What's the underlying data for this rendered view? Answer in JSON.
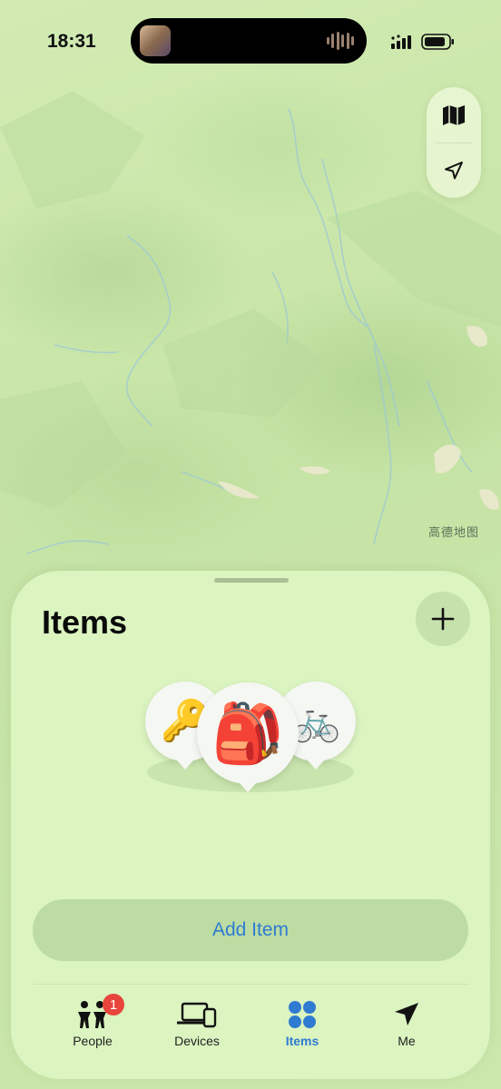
{
  "status_bar": {
    "time": "18:31"
  },
  "map": {
    "attribution": "高德地图"
  },
  "map_controls": {
    "map_mode_icon": "map-icon",
    "locate_icon": "location-arrow-icon"
  },
  "sheet": {
    "title": "Items",
    "add_icon": "plus-icon",
    "items": [
      {
        "name": "keys",
        "emoji": "🔑"
      },
      {
        "name": "backpack",
        "emoji": "🎒"
      },
      {
        "name": "bike",
        "emoji": "🚲"
      }
    ],
    "add_item_label": "Add Item"
  },
  "tab_bar": {
    "tabs": [
      {
        "label": "People",
        "icon": "people-icon",
        "badge": "1",
        "active": false
      },
      {
        "label": "Devices",
        "icon": "devices-icon",
        "active": false
      },
      {
        "label": "Items",
        "icon": "items-icon",
        "active": true
      },
      {
        "label": "Me",
        "icon": "location-arrow-icon",
        "active": false
      }
    ]
  },
  "colors": {
    "accent": "#2f7bd1",
    "badge": "#e8453c",
    "sheet": "#dbf4c0",
    "map": "#c9e7a6"
  }
}
